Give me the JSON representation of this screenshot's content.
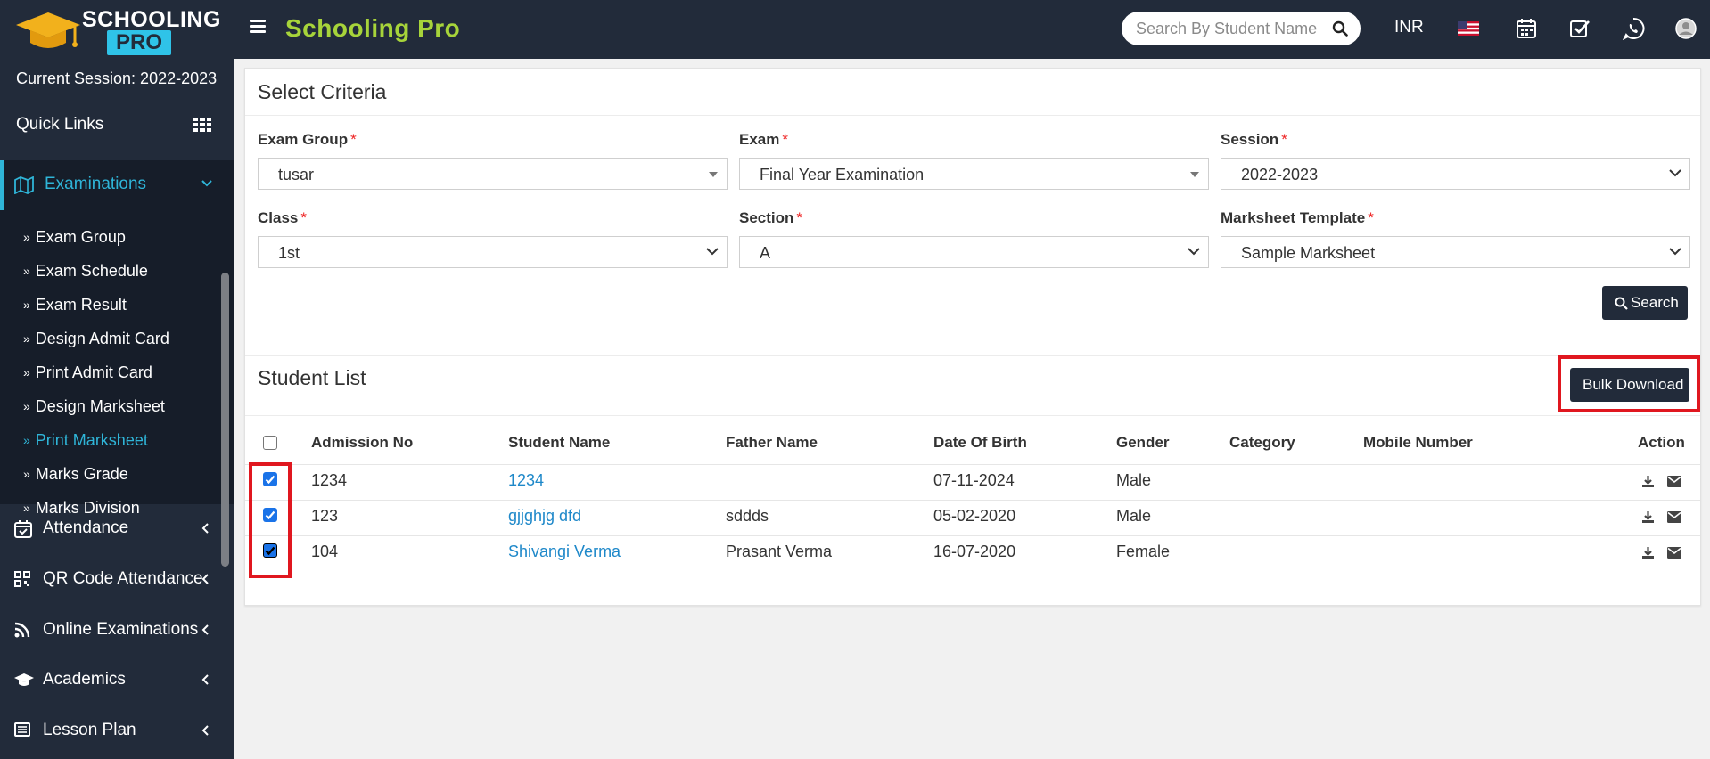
{
  "app": {
    "logo_line1": "SCHOOLING",
    "logo_line2": "PRO",
    "brand": "Schooling Pro",
    "search_placeholder": "Search By Student Name",
    "currency": "INR"
  },
  "sidebar": {
    "session": "Current Session: 2022-2023",
    "quick_links": "Quick Links",
    "active_menu": "Examinations",
    "submenu": [
      {
        "label": "Exam Group"
      },
      {
        "label": "Exam Schedule"
      },
      {
        "label": "Exam Result"
      },
      {
        "label": "Design Admit Card"
      },
      {
        "label": "Print Admit Card"
      },
      {
        "label": "Design Marksheet"
      },
      {
        "label": "Print Marksheet"
      },
      {
        "label": "Marks Grade"
      },
      {
        "label": "Marks Division"
      }
    ],
    "menu": [
      {
        "label": "Attendance"
      },
      {
        "label": "QR Code Attendance"
      },
      {
        "label": "Online Examinations"
      },
      {
        "label": "Academics"
      },
      {
        "label": "Lesson Plan"
      }
    ]
  },
  "criteria": {
    "title": "Select Criteria",
    "exam_group": {
      "label": "Exam Group",
      "value": "tusar"
    },
    "exam": {
      "label": "Exam",
      "value": "Final Year Examination"
    },
    "session": {
      "label": "Session",
      "value": "2022-2023"
    },
    "class": {
      "label": "Class",
      "value": "1st"
    },
    "section": {
      "label": "Section",
      "value": "A"
    },
    "template": {
      "label": "Marksheet Template",
      "value": "Sample Marksheet"
    },
    "required_mark": "*",
    "search_button": "Search"
  },
  "students": {
    "title": "Student List",
    "bulk_button": "Bulk Download",
    "columns": [
      "Admission No",
      "Student Name",
      "Father Name",
      "Date Of Birth",
      "Gender",
      "Category",
      "Mobile Number",
      "Action"
    ],
    "rows": [
      {
        "admission": "1234",
        "name": "1234",
        "father": "",
        "dob": "07-11-2024",
        "gender": "Male",
        "category": "",
        "mobile": "",
        "checked": true
      },
      {
        "admission": "123",
        "name": "gjjghjg dfd",
        "father": "sddds",
        "dob": "05-02-2020",
        "gender": "Male",
        "category": "",
        "mobile": "",
        "checked": true
      },
      {
        "admission": "104",
        "name": "Shivangi Verma",
        "father": "Prasant Verma",
        "dob": "16-07-2020",
        "gender": "Female",
        "category": "",
        "mobile": "",
        "checked": true
      }
    ]
  },
  "colors": {
    "topbar": "#222b3a",
    "brand": "#a7d43a",
    "accent": "#2fb5d8",
    "link": "#1e88c9",
    "highlight": "#e0171f"
  }
}
